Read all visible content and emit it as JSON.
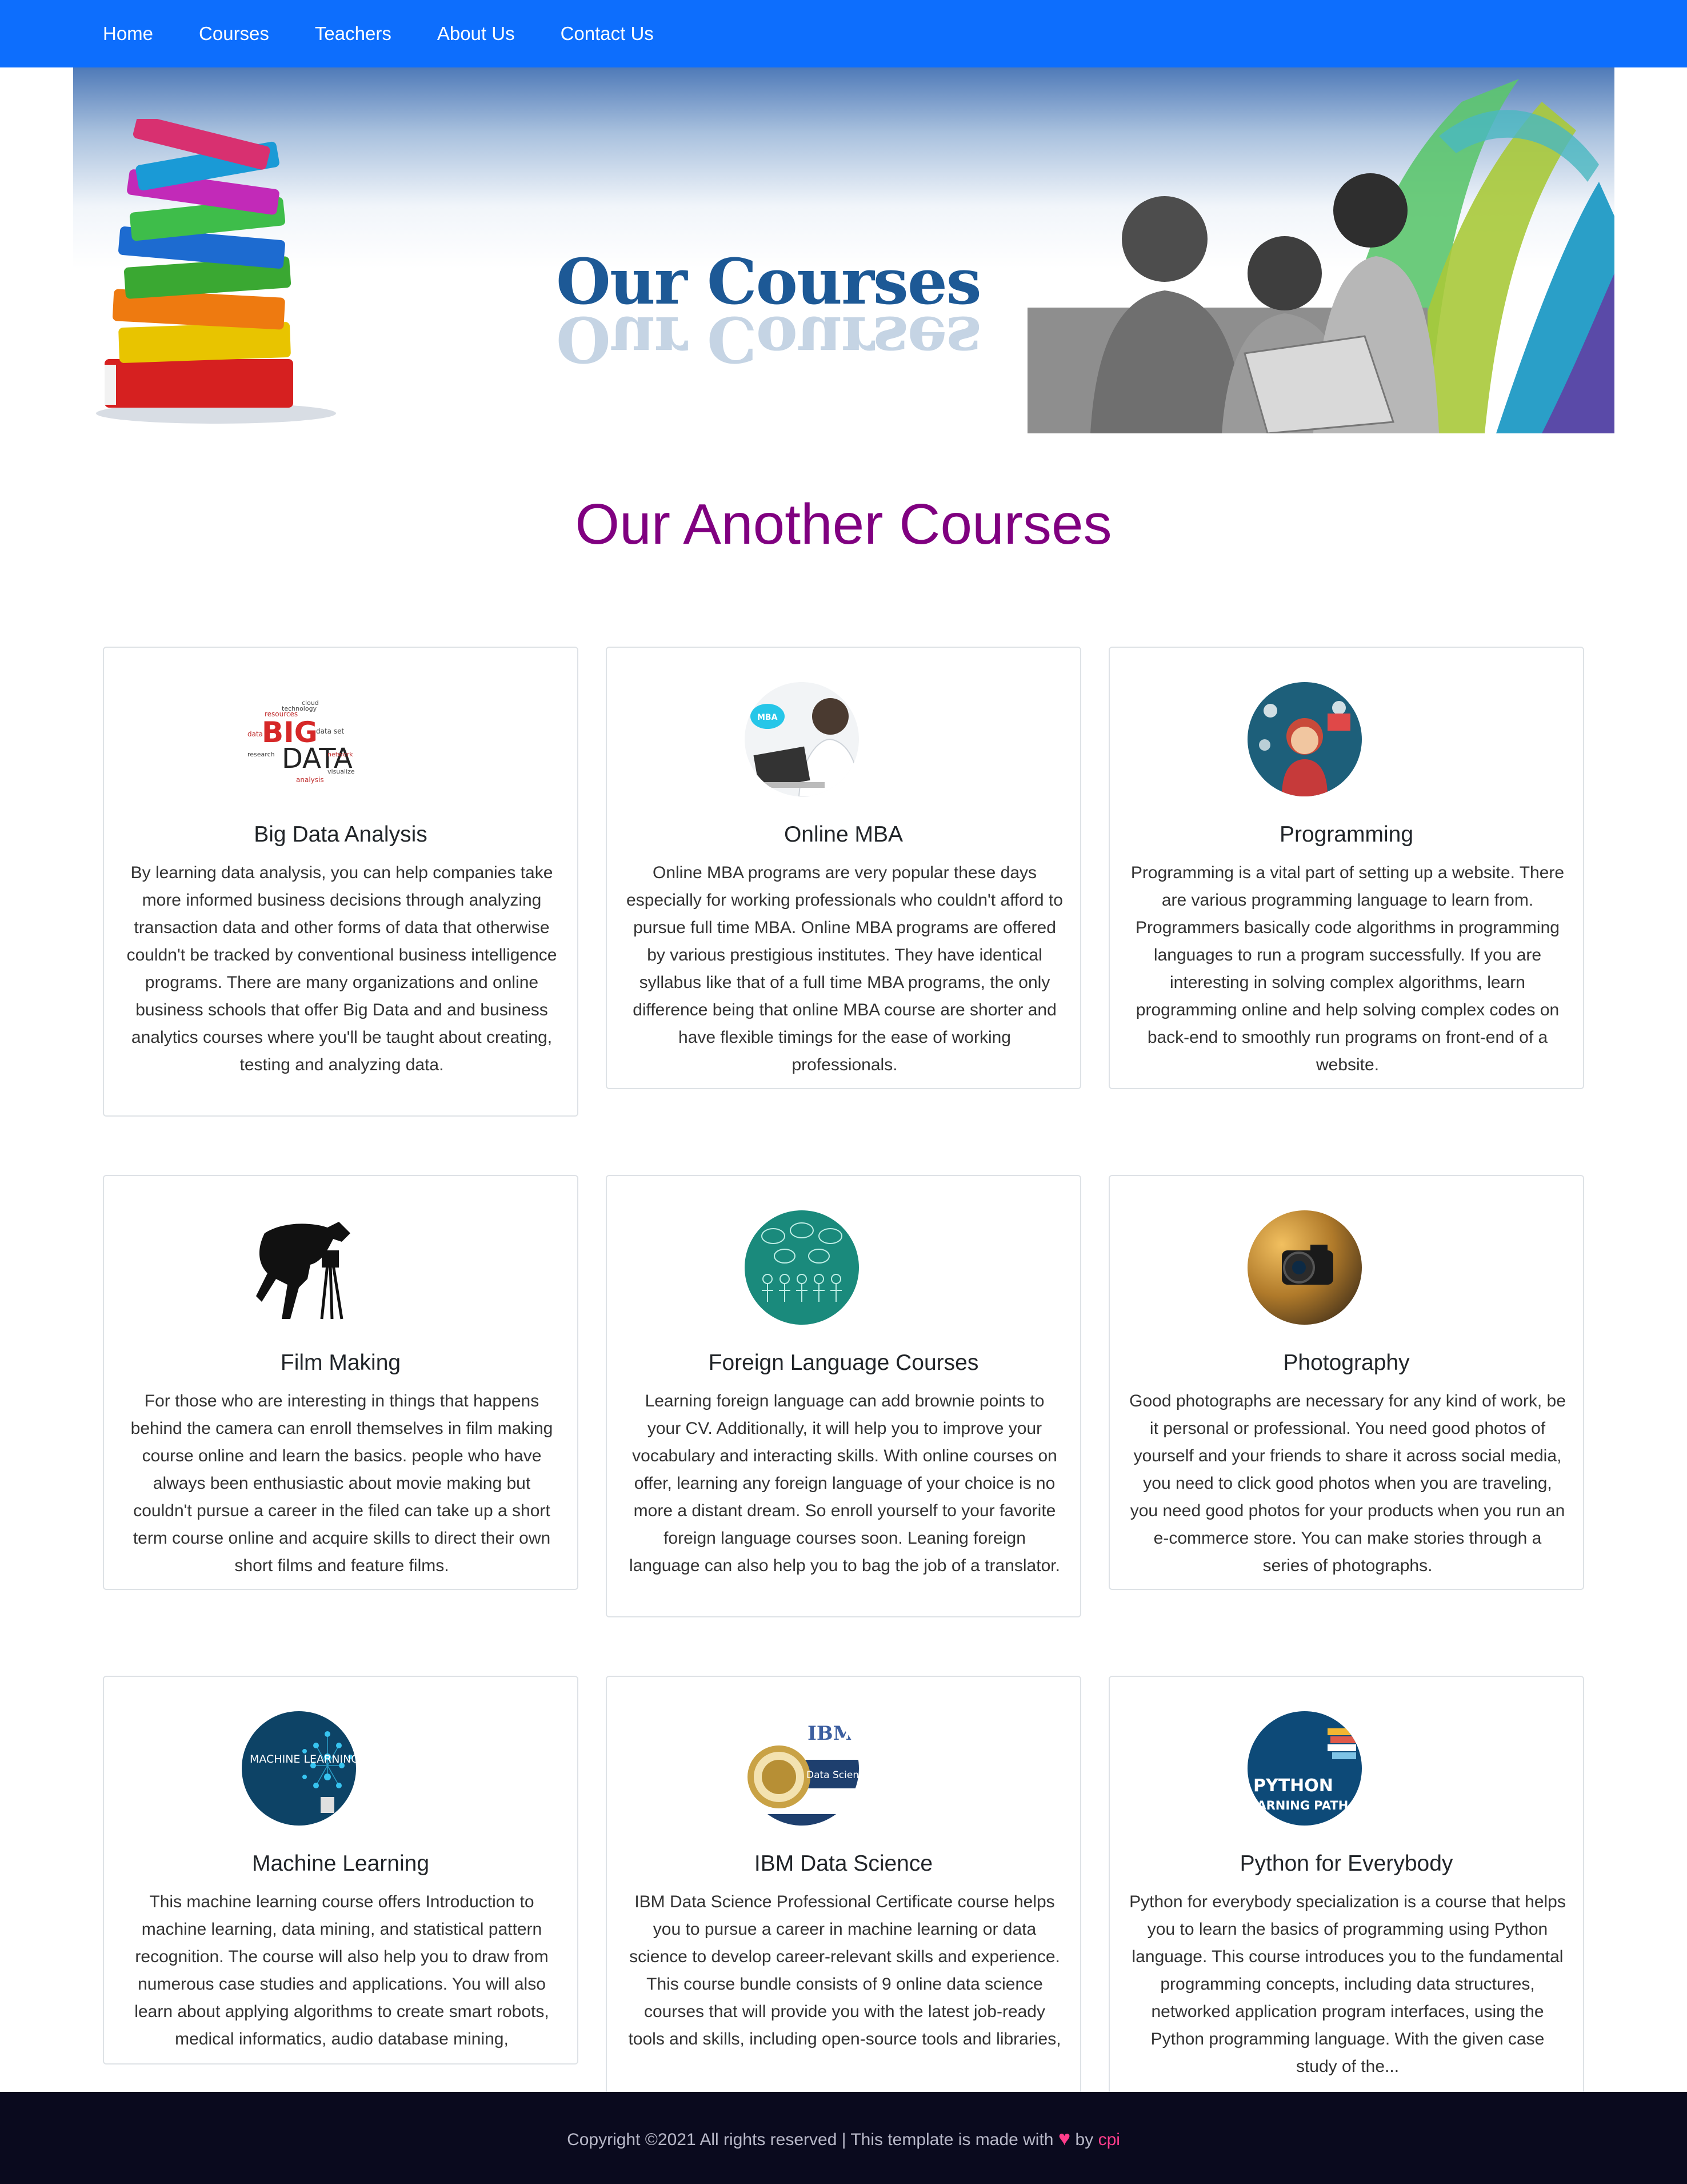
{
  "nav": {
    "items": [
      {
        "label": "Home"
      },
      {
        "label": "Courses"
      },
      {
        "label": "Teachers"
      },
      {
        "label": "About Us"
      },
      {
        "label": "Contact Us"
      }
    ]
  },
  "hero": {
    "title": "Our Courses",
    "title_color": "#1d5996"
  },
  "section": {
    "title": "Our Another Courses",
    "title_color": "#800080"
  },
  "courses": [
    {
      "title": "Big Data Analysis",
      "image": "big-data-word-cloud",
      "description": "By learning data analysis, you can help companies take more informed business decisions through analyzing transaction data and other forms of data that otherwise couldn't be tracked by conventional business intelligence programs. There are many organizations and online business schools that offer Big Data and and business analytics courses where you'll be taught about creating, testing and analyzing data."
    },
    {
      "title": "Online MBA",
      "image": "online-mba-photo",
      "description": "Online MBA programs are very popular these days especially for working professionals who couldn't afford to pursue full time MBA. Online MBA programs are offered by various prestigious institutes. They have identical syllabus like that of a full time MBA programs, the only difference being that online MBA course are shorter and have flexible timings for the ease of working professionals."
    },
    {
      "title": "Programming",
      "image": "programmer-illustration",
      "description": "Programming is a vital part of setting up a website. There are various programming language to learn from. Programmers basically code algorithms in programming languages to run a program successfully. If you are interesting in solving complex algorithms, learn programming online and help solving complex codes on back-end to smoothly run programs on front-end of a website."
    },
    {
      "title": "Film Making",
      "image": "cameraman-silhouette",
      "description": "For those who are interesting in things that happens behind the camera can enroll themselves in film making course online and learn the basics. people who have always been enthusiastic about movie making but couldn't pursue a career in the filed can take up a short term course online and acquire skills to direct their own short films and feature films."
    },
    {
      "title": "Foreign Language Courses",
      "image": "language-speech-bubbles",
      "description": "Learning foreign language can add brownie points to your CV. Additionally, it will help you to improve your vocabulary and interacting skills. With online courses on offer, learning any foreign language of your choice is no more a distant dream. So enroll yourself to your favorite foreign language courses soon. Leaning foreign language can also help you to bag the job of a translator."
    },
    {
      "title": "Photography",
      "image": "camera-photo",
      "description": "Good photographs are necessary for any kind of work, be it personal or professional. You need good photos of yourself and your friends to share it across social media, you need to click good photos when you are traveling, you need good photos for your products when you run an e-commerce store. You can make stories through a series of photographs."
    },
    {
      "title": "Machine Learning",
      "image": "machine-learning-bulb",
      "image_text": "MACHINE LEARNING",
      "description": "This machine learning course offers Introduction to machine learning, data mining, and statistical pattern recognition. The course will also help you to draw from numerous case studies and applications. You will also learn about applying algorithms to create smart robots, medical informatics, audio database mining,"
    },
    {
      "title": "IBM Data Science",
      "image": "ibm-certificate-badge",
      "image_text": "IBM.",
      "image_subtext": "Data Science",
      "description": "IBM Data Science Professional Certificate course helps you to pursue a career in machine learning or data science to develop career-relevant skills and experience. This course bundle consists of 9 online data science courses that will provide you with the latest job-ready tools and skills, including open-source tools and libraries,"
    },
    {
      "title": "Python for Everybody",
      "image": "python-learning-path",
      "image_text": "PYTHON",
      "image_subtext": "EARNING PATH",
      "description": "Python for everybody specialization is a course that helps you to learn the basics of programming using Python language. This course introduces you to the fundamental programming concepts, including data structures, networked application program interfaces, using the Python programming language. With the given case study of the..."
    }
  ],
  "footer": {
    "prefix": "Copyright ©2021 All rights reserved | This template is made with",
    "heart": "♥",
    "by": "by",
    "author": "cpi",
    "author_color": "#ff3d8b"
  },
  "colors": {
    "navbar": "#0d6efd",
    "footer": "#0a0a1e"
  }
}
